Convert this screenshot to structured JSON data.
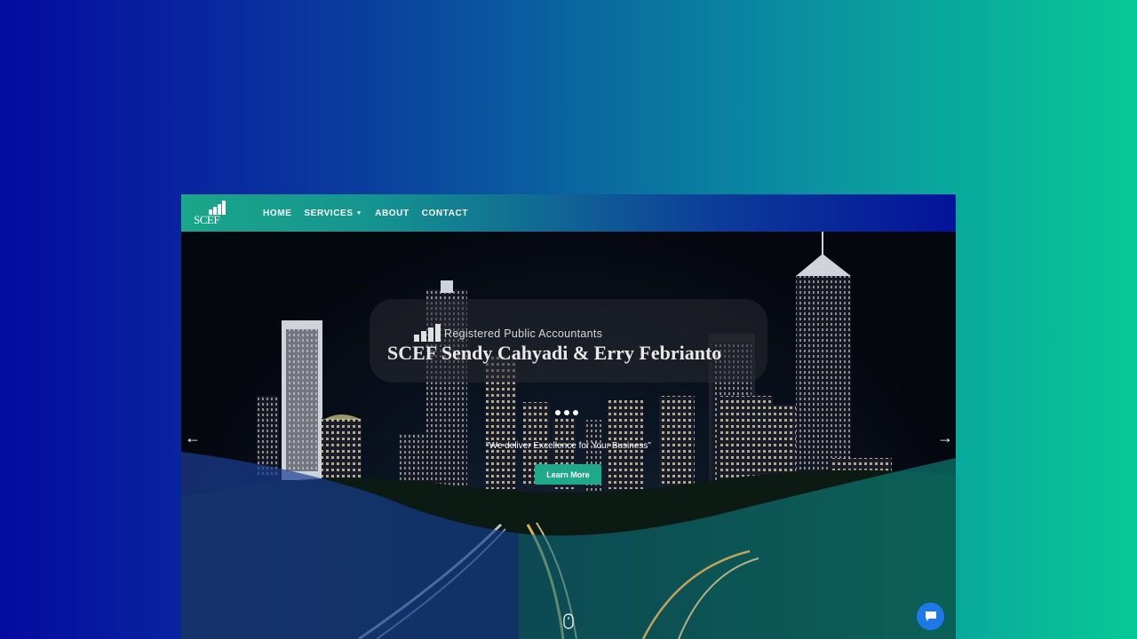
{
  "nav": {
    "logo_text": "SCEF",
    "items": [
      {
        "label": "HOME"
      },
      {
        "label": "SERVICES"
      },
      {
        "label": "ABOUT"
      },
      {
        "label": "CONTACT"
      }
    ]
  },
  "hero": {
    "subtitle": "Registered Public Accountants",
    "title": "SCEF Sendy Cahyadi & Erry Febrianto",
    "tagline": "\"We deliver Excellence for Your Business\"",
    "cta_label": "Learn More"
  },
  "colors": {
    "accent": "#1ea98a",
    "chat": "#1f78e8"
  },
  "icons": {
    "prev": "arrow-left-icon",
    "next": "arrow-right-icon",
    "scroll": "mouse-scroll-icon",
    "chat": "chat-bubble-icon"
  }
}
